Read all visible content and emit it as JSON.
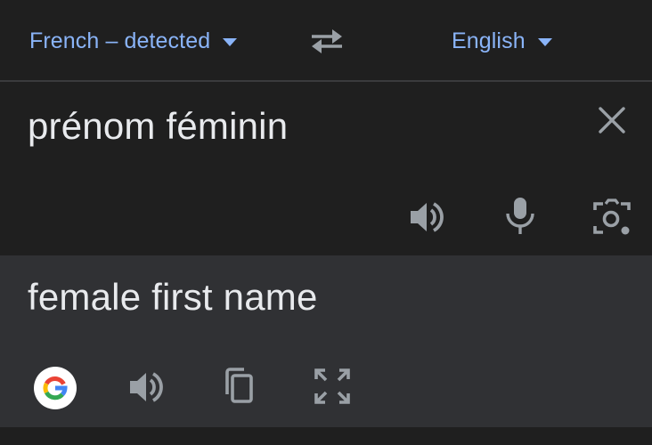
{
  "colors": {
    "link": "#8ab4f8",
    "text": "#e8eaed",
    "icon": "#9aa0a6",
    "background": "#1f1f1f",
    "result_background": "#303134"
  },
  "language_bar": {
    "source_language": "French – detected",
    "target_language": "English",
    "swap_icon": "swap-horiz-icon"
  },
  "source": {
    "text": "prénom féminin",
    "clear_icon": "close-icon",
    "actions": [
      "volume-icon",
      "mic-icon",
      "camera-icon"
    ]
  },
  "result": {
    "text": "female first name",
    "actions": [
      "google-logo",
      "volume-icon",
      "copy-icon",
      "fullscreen-icon"
    ]
  }
}
